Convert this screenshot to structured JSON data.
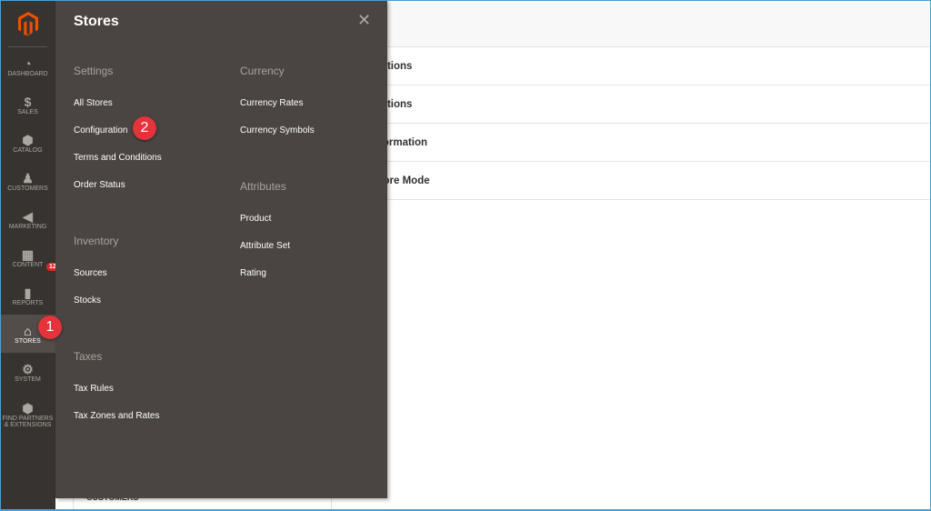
{
  "sidebar": {
    "items": [
      {
        "label": "DASHBOARD",
        "icon": "dashboard-icon"
      },
      {
        "label": "SALES",
        "icon": "dollar-icon"
      },
      {
        "label": "CATALOG",
        "icon": "box-icon"
      },
      {
        "label": "CUSTOMERS",
        "icon": "person-icon"
      },
      {
        "label": "MARKETING",
        "icon": "megaphone-icon"
      },
      {
        "label": "CONTENT",
        "icon": "layout-icon"
      },
      {
        "label": "REPORTS",
        "icon": "bar-chart-icon"
      },
      {
        "label": "STORES",
        "icon": "store-icon",
        "active": true
      },
      {
        "label": "SYSTEM",
        "icon": "gear-icon"
      },
      {
        "label": "FIND PARTNERS & EXTENSIONS",
        "icon": "cube-icon"
      }
    ],
    "notifications": "12"
  },
  "callouts": [
    "1",
    "2"
  ],
  "panel": {
    "title": "Stores",
    "col1": [
      {
        "heading": "Settings",
        "items": [
          "All Stores",
          "Configuration",
          "Terms and Conditions",
          "Order Status"
        ]
      },
      {
        "heading": "Inventory",
        "items": [
          "Sources",
          "Stocks"
        ]
      },
      {
        "heading": "Taxes",
        "items": [
          "Tax Rules",
          "Tax Zones and Rates"
        ]
      }
    ],
    "col2": [
      {
        "heading": "Currency",
        "items": [
          "Currency Rates",
          "Currency Symbols"
        ]
      },
      {
        "heading": "Attributes",
        "items": [
          "Product",
          "Attribute Set",
          "Rating"
        ]
      }
    ]
  },
  "content": {
    "rows": [
      "Options",
      "Options",
      "nformation",
      "Store Mode"
    ],
    "left_item": "CUSTOMERS"
  },
  "colors": {
    "accent": "#eb5202",
    "callout": "#e5323b",
    "panel": "#4a4542",
    "sidebar": "#373330"
  }
}
